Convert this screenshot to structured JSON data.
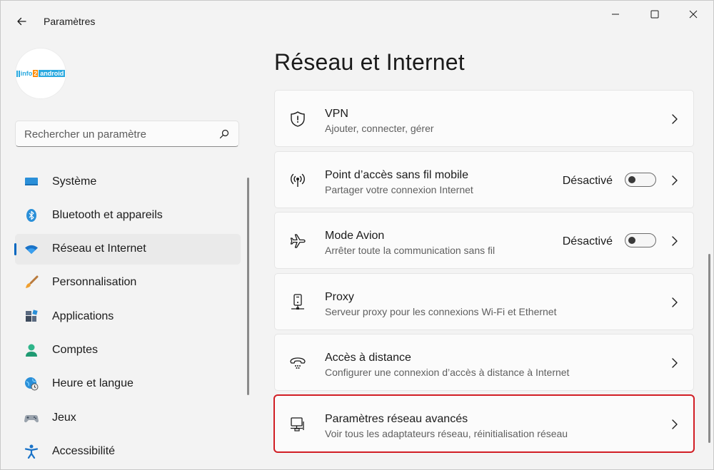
{
  "window": {
    "title": "Paramètres"
  },
  "profile": {
    "logo": {
      "part1": "info",
      "part2": "2",
      "part3": "android"
    }
  },
  "search": {
    "placeholder": "Rechercher un paramètre"
  },
  "nav": {
    "items": [
      {
        "label": "Système",
        "icon": "monitor-icon"
      },
      {
        "label": "Bluetooth et appareils",
        "icon": "bluetooth-icon"
      },
      {
        "label": "Réseau et Internet",
        "icon": "wifi-icon",
        "selected": true
      },
      {
        "label": "Personnalisation",
        "icon": "paintbrush-icon"
      },
      {
        "label": "Applications",
        "icon": "apps-icon"
      },
      {
        "label": "Comptes",
        "icon": "person-icon"
      },
      {
        "label": "Heure et langue",
        "icon": "globe-clock-icon"
      },
      {
        "label": "Jeux",
        "icon": "gamepad-icon"
      },
      {
        "label": "Accessibilité",
        "icon": "accessibility-icon"
      }
    ]
  },
  "main": {
    "title": "Réseau et Internet",
    "cards": [
      {
        "title": "VPN",
        "subtitle": "Ajouter, connecter, gérer",
        "icon": "shield-icon"
      },
      {
        "title": "Point d’accès sans fil mobile",
        "subtitle": "Partager votre connexion Internet",
        "icon": "hotspot-icon",
        "state": "Désactivé",
        "toggle_on": false
      },
      {
        "title": "Mode Avion",
        "subtitle": "Arrêter toute la communication sans fil",
        "icon": "airplane-icon",
        "state": "Désactivé",
        "toggle_on": false
      },
      {
        "title": "Proxy",
        "subtitle": "Serveur proxy pour les connexions Wi-Fi et Ethernet",
        "icon": "proxy-icon"
      },
      {
        "title": "Accès à distance",
        "subtitle": "Configurer une connexion d’accès à distance à Internet",
        "icon": "dialup-icon"
      },
      {
        "title": "Paramètres réseau avancés",
        "subtitle": "Voir tous les adaptateurs réseau, réinitialisation réseau",
        "icon": "network-computer-icon",
        "highlighted": true
      }
    ]
  },
  "colors": {
    "accent": "#0067c0",
    "highlight": "#d11e25",
    "background": "#f3f3f3",
    "card": "#fbfbfb"
  }
}
